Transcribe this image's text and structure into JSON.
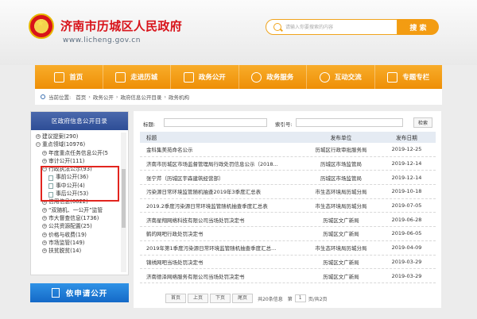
{
  "header": {
    "site_title": "济南市历城区人民政府",
    "site_url": "www.licheng.gov.cn",
    "search_placeholder": "请输入你要搜索的内容",
    "search_button": "搜 索"
  },
  "nav": [
    {
      "label": "首页",
      "icon": "home-icon"
    },
    {
      "label": "走进历城",
      "icon": "building-icon"
    },
    {
      "label": "政务公开",
      "icon": "document-icon"
    },
    {
      "label": "政务服务",
      "icon": "service-icon"
    },
    {
      "label": "互动交流",
      "icon": "chat-icon"
    },
    {
      "label": "专题专栏",
      "icon": "book-icon"
    }
  ],
  "breadcrumb": {
    "prefix": "当前位置:",
    "items": [
      "首页",
      "政务公开",
      "政府信息公开目录",
      "政务机构"
    ]
  },
  "sidebar": {
    "header": "区政府信息公开目录",
    "tree": [
      {
        "label": "建议提案(290)",
        "level": 1,
        "toggle": "+"
      },
      {
        "label": "重点领域(10976)",
        "level": 1,
        "toggle": "-"
      },
      {
        "label": "年度重点任务信息公开(5",
        "level": 2,
        "toggle": "+"
      },
      {
        "label": "审计公开(111)",
        "level": 2,
        "toggle": "+"
      },
      {
        "label": "行政执法公示(93)",
        "level": 2,
        "toggle": "-"
      },
      {
        "label": "事前公开(36)",
        "level": 3,
        "toggle": "leaf"
      },
      {
        "label": "事中公开(4)",
        "level": 3,
        "toggle": "leaf"
      },
      {
        "label": "事后公开(53)",
        "level": 3,
        "toggle": "leaf"
      },
      {
        "label": "信用信息(6622)",
        "level": 2,
        "toggle": "+"
      },
      {
        "label": "“双随机、一公开”监管",
        "level": 2,
        "toggle": "+"
      },
      {
        "label": "市大督查信息(1736)",
        "level": 2,
        "toggle": "+"
      },
      {
        "label": "公共资源配置(25)",
        "level": 2,
        "toggle": "+"
      },
      {
        "label": "价格与收费(19)",
        "level": 2,
        "toggle": "+"
      },
      {
        "label": "市场监管(149)",
        "level": 2,
        "toggle": "+"
      },
      {
        "label": "扶贫脱贫(14)",
        "level": 2,
        "toggle": "+"
      }
    ],
    "apply_banner": "依申请公开"
  },
  "filter": {
    "title_label": "标题:",
    "index_label": "索引号:",
    "search_button": "检索"
  },
  "table": {
    "headers": [
      "标题",
      "发布单位",
      "发布日期"
    ],
    "rows": [
      {
        "title": "金科集美苑命名公示",
        "unit": "历城区行政审批服务局",
        "date": "2019-12-25"
      },
      {
        "title": "济南市历城区市场监督管理局行政处罚信息公示（2018...",
        "unit": "历城区市场监管局",
        "date": "2019-12-14"
      },
      {
        "title": "张宁芹（历城区宇森建筑经营部）",
        "unit": "历城区市场监管局",
        "date": "2019-12-14"
      },
      {
        "title": "污染源日常环境监管随机抽查2019年3季度汇总表",
        "unit": "市生态环境局历城分局",
        "date": "2019-10-18"
      },
      {
        "title": "2019.2季度污染源日常环境监管随机抽查季度汇总表",
        "unit": "市生态环境局历城分局",
        "date": "2019-07-05"
      },
      {
        "title": "济南星翔网络科技有限公司当场处罚决定书",
        "unit": "历城区文广新局",
        "date": "2019-06-28"
      },
      {
        "title": "鹤的网吧行政处罚决定书",
        "unit": "历城区文广新局",
        "date": "2019-06-05"
      },
      {
        "title": "2019年第1季度污染源日常环境监管随机抽查季度汇总...",
        "unit": "市生态环境局历城分局",
        "date": "2019-04-09"
      },
      {
        "title": "锦绣网吧当场处罚决定书",
        "unit": "历城区文广新局",
        "date": "2019-03-29"
      },
      {
        "title": "济南德泽网络服务有限公司当场处罚决定书",
        "unit": "历城区文广新局",
        "date": "2019-03-29"
      }
    ]
  },
  "pagination": {
    "first": "首页",
    "prev": "上页",
    "next": "下页",
    "last": "尾页",
    "info_prefix": "共20条信息",
    "go_to": "第",
    "current_page": "1",
    "page_info": "页/共2页"
  }
}
